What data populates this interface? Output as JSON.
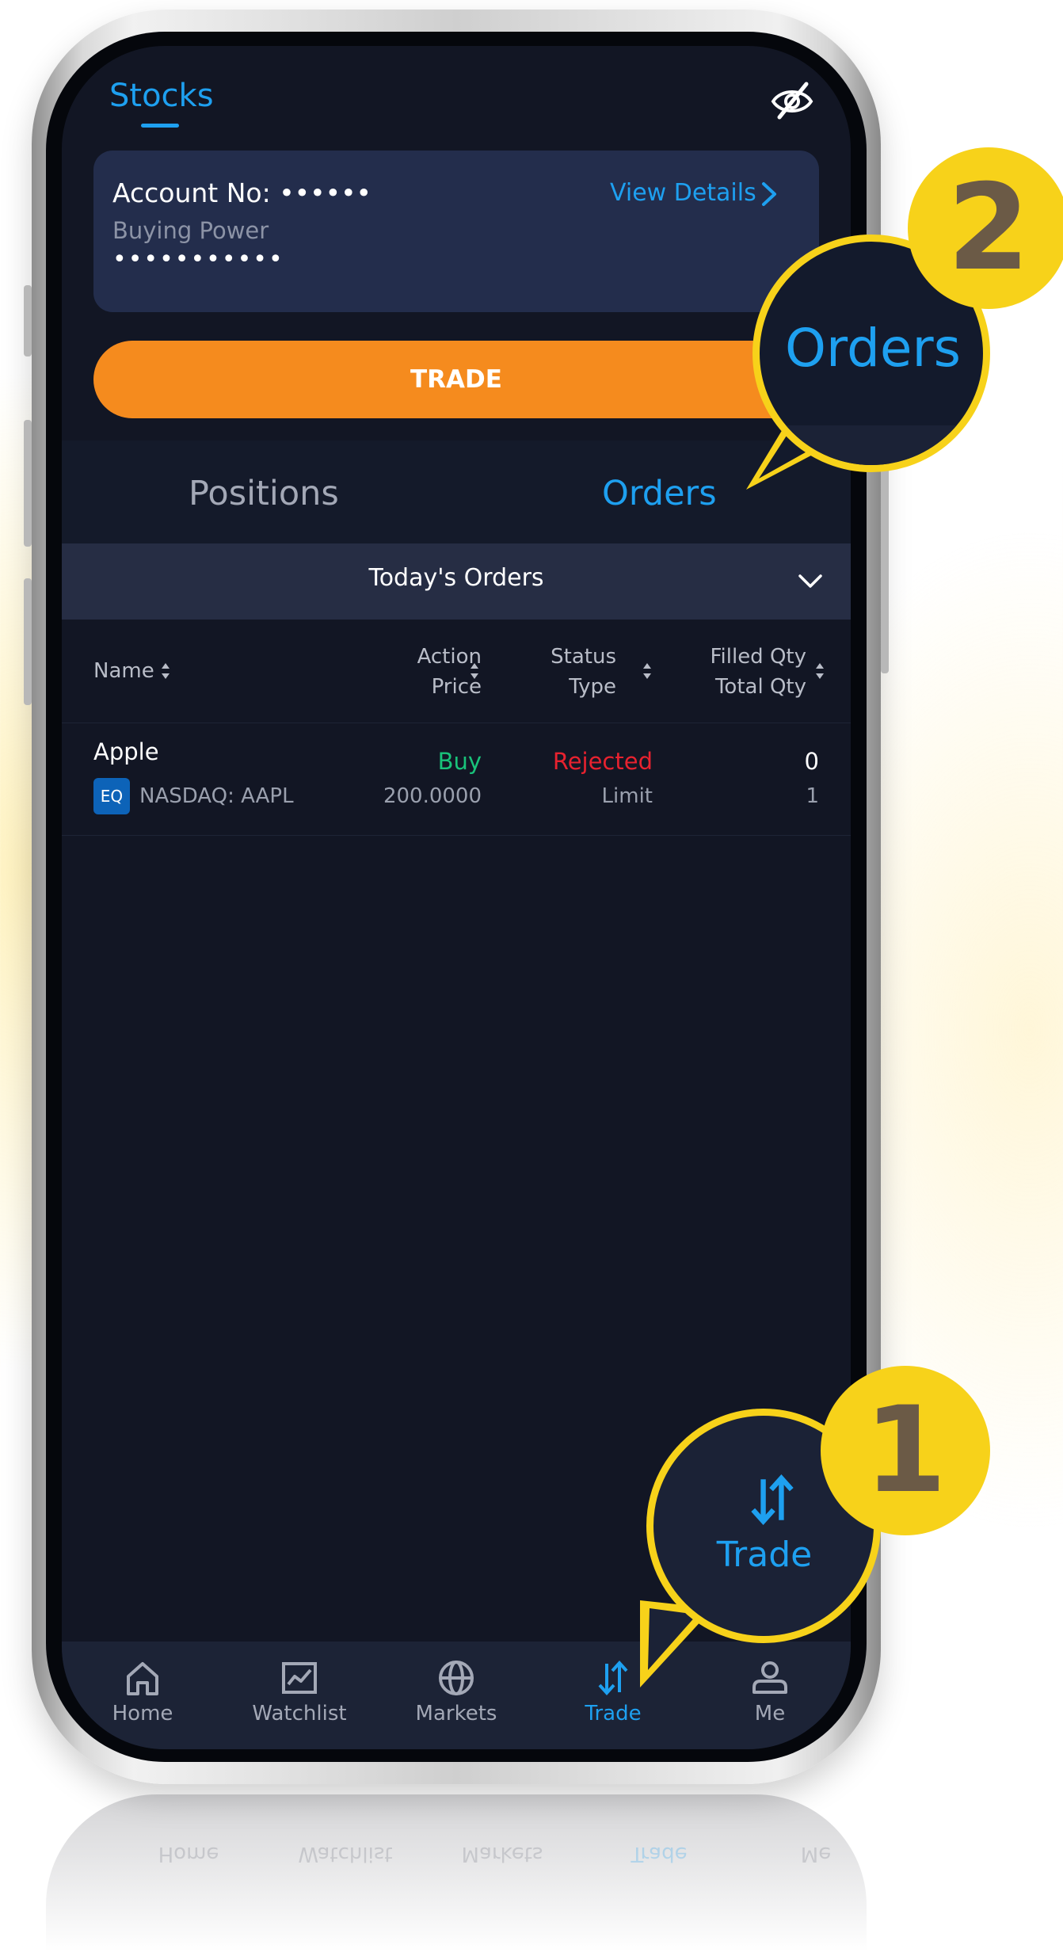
{
  "header": {
    "title": "Stocks",
    "privacy_toggle_icon": "eye-slash-icon"
  },
  "account": {
    "account_no": "Account No: ••••••",
    "view_details": "View Details",
    "buying_power_label": "Buying Power",
    "buying_power_value": "•••••••••••"
  },
  "trade_button": "TRADE",
  "tabs": [
    {
      "label": "Positions",
      "active": false
    },
    {
      "label": "Orders",
      "active": true
    }
  ],
  "orders_filter": {
    "selected": "Today's Orders"
  },
  "table": {
    "columns": [
      {
        "line1": "Name",
        "line2": ""
      },
      {
        "line1": "Action",
        "line2": "Price"
      },
      {
        "line1": "Status",
        "line2": "Type"
      },
      {
        "line1": "Filled Qty",
        "line2": "Total Qty"
      }
    ],
    "rows": [
      {
        "name": "Apple",
        "badge": "EQ",
        "symbol": "NASDAQ: AAPL",
        "action": "Buy",
        "price": "200.0000",
        "status": "Rejected",
        "type": "Limit",
        "filled_qty": "0",
        "total_qty": "1"
      }
    ]
  },
  "bottom_nav": [
    {
      "label": "Home",
      "icon": "home-icon",
      "active": false
    },
    {
      "label": "Watchlist",
      "icon": "chart-icon",
      "active": false
    },
    {
      "label": "Markets",
      "icon": "globe-icon",
      "active": false
    },
    {
      "label": "Trade",
      "icon": "trade-arrows-icon",
      "active": true
    },
    {
      "label": "Me",
      "icon": "person-icon",
      "active": false
    }
  ],
  "callouts": [
    {
      "number": "1",
      "label": "Trade"
    },
    {
      "number": "2",
      "label": "Orders"
    }
  ],
  "colors": {
    "accent": "#1ea0f0",
    "trade_button": "#f58b1e",
    "buy": "#19c27a",
    "rejected": "#e8222f",
    "callout": "#f7d21a",
    "background": "#121624"
  }
}
